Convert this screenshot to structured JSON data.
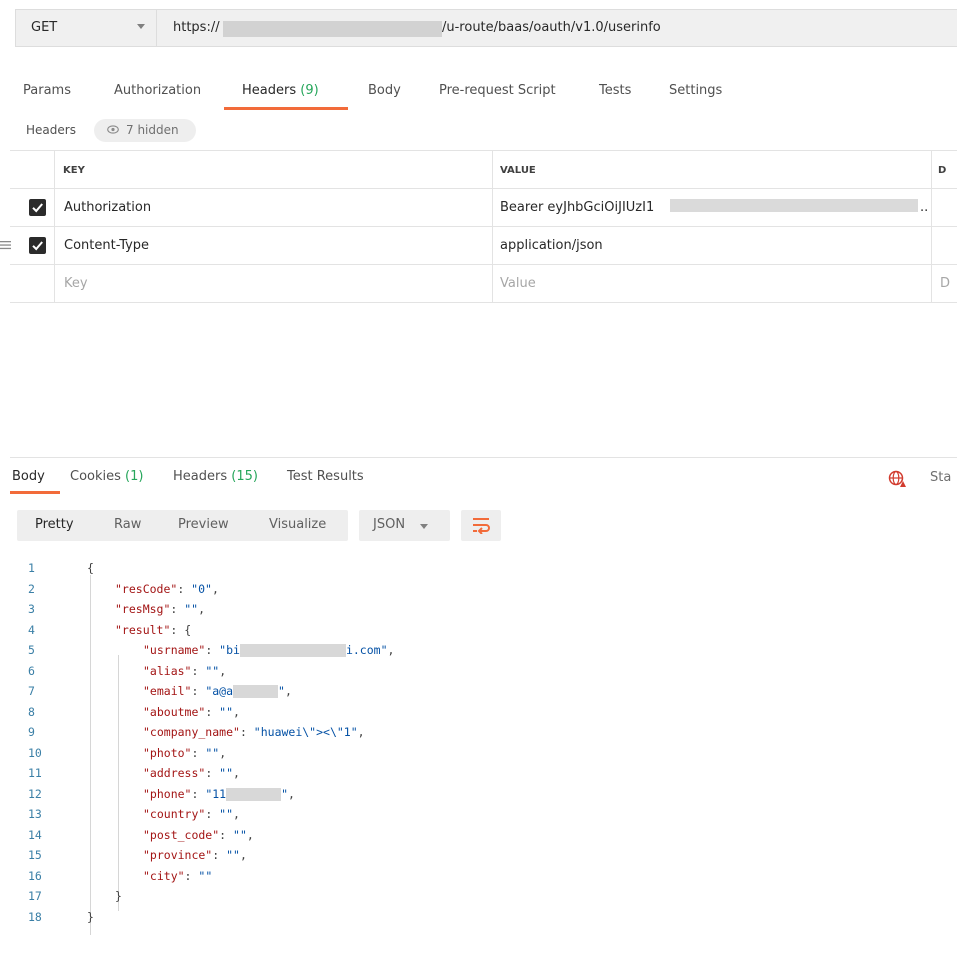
{
  "request": {
    "method": "GET",
    "url_prefix": "https://",
    "url_suffix": "/u-route/baas/oauth/v1.0/userinfo"
  },
  "request_tabs": [
    {
      "label": "Params"
    },
    {
      "label": "Authorization"
    },
    {
      "label": "Headers",
      "count": "(9)"
    },
    {
      "label": "Body"
    },
    {
      "label": "Pre-request Script"
    },
    {
      "label": "Tests"
    },
    {
      "label": "Settings"
    }
  ],
  "headers_section": {
    "label": "Headers",
    "hidden_count": "7 hidden"
  },
  "headers_table": {
    "col_key": "KEY",
    "col_value": "VALUE",
    "col_desc": "D",
    "rows": [
      {
        "key": "Authorization",
        "value": "Bearer eyJhbGciOiJIUzI1",
        "value_trunc": "..",
        "checked": true
      },
      {
        "key": "Content-Type",
        "value": "application/json",
        "checked": true
      }
    ],
    "placeholder_key": "Key",
    "placeholder_value": "Value",
    "placeholder_desc": "D"
  },
  "response_tabs": [
    {
      "label": "Body"
    },
    {
      "label": "Cookies",
      "count": "(1)"
    },
    {
      "label": "Headers",
      "count": "(15)"
    },
    {
      "label": "Test Results"
    }
  ],
  "status_label": "Sta",
  "view_modes": [
    "Pretty",
    "Raw",
    "Preview",
    "Visualize"
  ],
  "format": "JSON",
  "code_lines": [
    {
      "n": "1",
      "indent": 0,
      "raw": "{"
    },
    {
      "n": "2",
      "indent": 1,
      "key": "\"resCode\"",
      "val": "\"0\"",
      "end": ","
    },
    {
      "n": "3",
      "indent": 1,
      "key": "\"resMsg\"",
      "val": "\"\"",
      "end": ","
    },
    {
      "n": "4",
      "indent": 1,
      "key": "\"result\"",
      "val": "",
      "end": "{"
    },
    {
      "n": "5",
      "indent": 2,
      "key": "\"usrname\"",
      "val": "\"bi",
      "tail": "i.com\"",
      "end": ","
    },
    {
      "n": "6",
      "indent": 2,
      "key": "\"alias\"",
      "val": "\"\"",
      "end": ","
    },
    {
      "n": "7",
      "indent": 2,
      "key": "\"email\"",
      "val": "\"a@a",
      "tail": "\"",
      "end": ","
    },
    {
      "n": "8",
      "indent": 2,
      "key": "\"aboutme\"",
      "val": "\"\"",
      "end": ","
    },
    {
      "n": "9",
      "indent": 2,
      "key": "\"company_name\"",
      "val": "\"huawei\\\"><\\\"1\"",
      "end": ","
    },
    {
      "n": "10",
      "indent": 2,
      "key": "\"photo\"",
      "val": "\"\"",
      "end": ","
    },
    {
      "n": "11",
      "indent": 2,
      "key": "\"address\"",
      "val": "\"\"",
      "end": ","
    },
    {
      "n": "12",
      "indent": 2,
      "key": "\"phone\"",
      "val": "\"11",
      "tail": "\"",
      "end": ","
    },
    {
      "n": "13",
      "indent": 2,
      "key": "\"country\"",
      "val": "\"\"",
      "end": ","
    },
    {
      "n": "14",
      "indent": 2,
      "key": "\"post_code\"",
      "val": "\"\"",
      "end": ","
    },
    {
      "n": "15",
      "indent": 2,
      "key": "\"province\"",
      "val": "\"\"",
      "end": ","
    },
    {
      "n": "16",
      "indent": 2,
      "key": "\"city\"",
      "val": "\"\"",
      "end": ""
    },
    {
      "n": "17",
      "indent": 1,
      "raw": "}"
    },
    {
      "n": "18",
      "indent": 0,
      "raw": "}"
    }
  ],
  "colors": {
    "accent": "#f26b3a",
    "count_green": "#26a65b",
    "json_key": "#a31515",
    "json_string": "#0451a5",
    "line_number": "#3a7fa6"
  },
  "icons": [
    "chevron-down-icon",
    "eye-icon",
    "checkbox-checked-icon",
    "drag-handle-icon",
    "globe-icon",
    "wrap-lines-icon"
  ]
}
